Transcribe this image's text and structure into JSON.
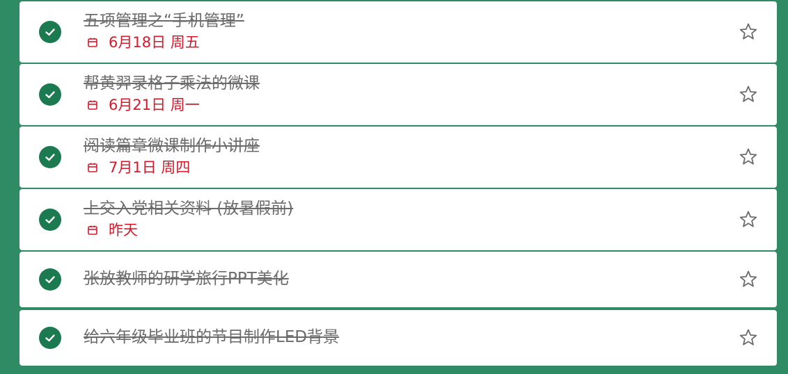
{
  "colors": {
    "background": "#2e8b63",
    "check": "#1b7a4f",
    "due": "#d7182a",
    "title": "#6b6b6b"
  },
  "tasks": [
    {
      "title": "五项管理之“手机管理”",
      "due": "6月18日 周五",
      "completed": true,
      "starred": false
    },
    {
      "title": "帮黄羿录格子乘法的微课",
      "due": "6月21日 周一",
      "completed": true,
      "starred": false
    },
    {
      "title": "阅读篇章微课制作小讲座",
      "due": "7月1日 周四",
      "completed": true,
      "starred": false
    },
    {
      "title": "上交入党相关资料 (放暑假前)",
      "due": "昨天",
      "completed": true,
      "starred": false
    },
    {
      "title": "张放教师的研学旅行PPT美化",
      "due": "",
      "completed": true,
      "starred": false
    },
    {
      "title": "给六年级毕业班的节目制作LED背景",
      "due": "",
      "completed": true,
      "starred": false
    }
  ]
}
